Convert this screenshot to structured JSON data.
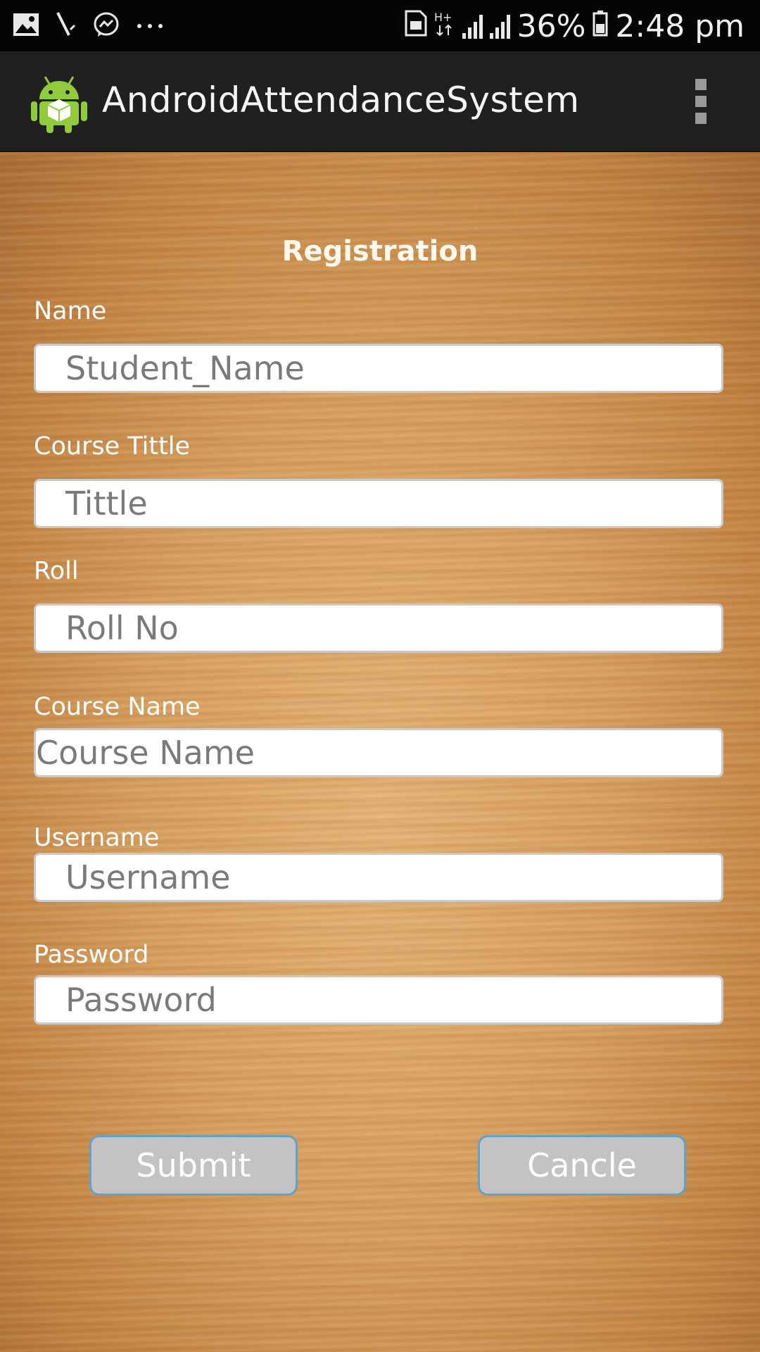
{
  "status_bar": {
    "battery_percent": "36%",
    "time": "2:48 pm",
    "left_icons": [
      "gallery-icon",
      "tool-icon",
      "messenger-icon",
      "more-dots-icon"
    ],
    "right_icons": [
      "sim-icon",
      "data-hplus-icon",
      "signal-1-icon",
      "signal-2-icon",
      "battery-icon"
    ]
  },
  "action_bar": {
    "title": "AndroidAttendanceSystem",
    "icon": "android-app-icon",
    "menu_icon": "overflow-menu-icon"
  },
  "form": {
    "heading": "Registration",
    "name": {
      "label": "Name",
      "placeholder": "Student_Name"
    },
    "course_title": {
      "label": "Course Tittle",
      "placeholder": "Tittle"
    },
    "roll": {
      "label": "Roll",
      "placeholder": "Roll No"
    },
    "course_name": {
      "label": "Course Name",
      "placeholder": "Course Name"
    },
    "username": {
      "label": "Username",
      "placeholder": "Username"
    },
    "password": {
      "label": "Password",
      "placeholder": "Password"
    }
  },
  "buttons": {
    "submit": "Submit",
    "cancel": "Cancle"
  },
  "colors": {
    "accent_border": "#5fa3cc",
    "button_fill": "#c3c3c3",
    "action_bar": "#202020",
    "wood": "#d59d5c"
  }
}
